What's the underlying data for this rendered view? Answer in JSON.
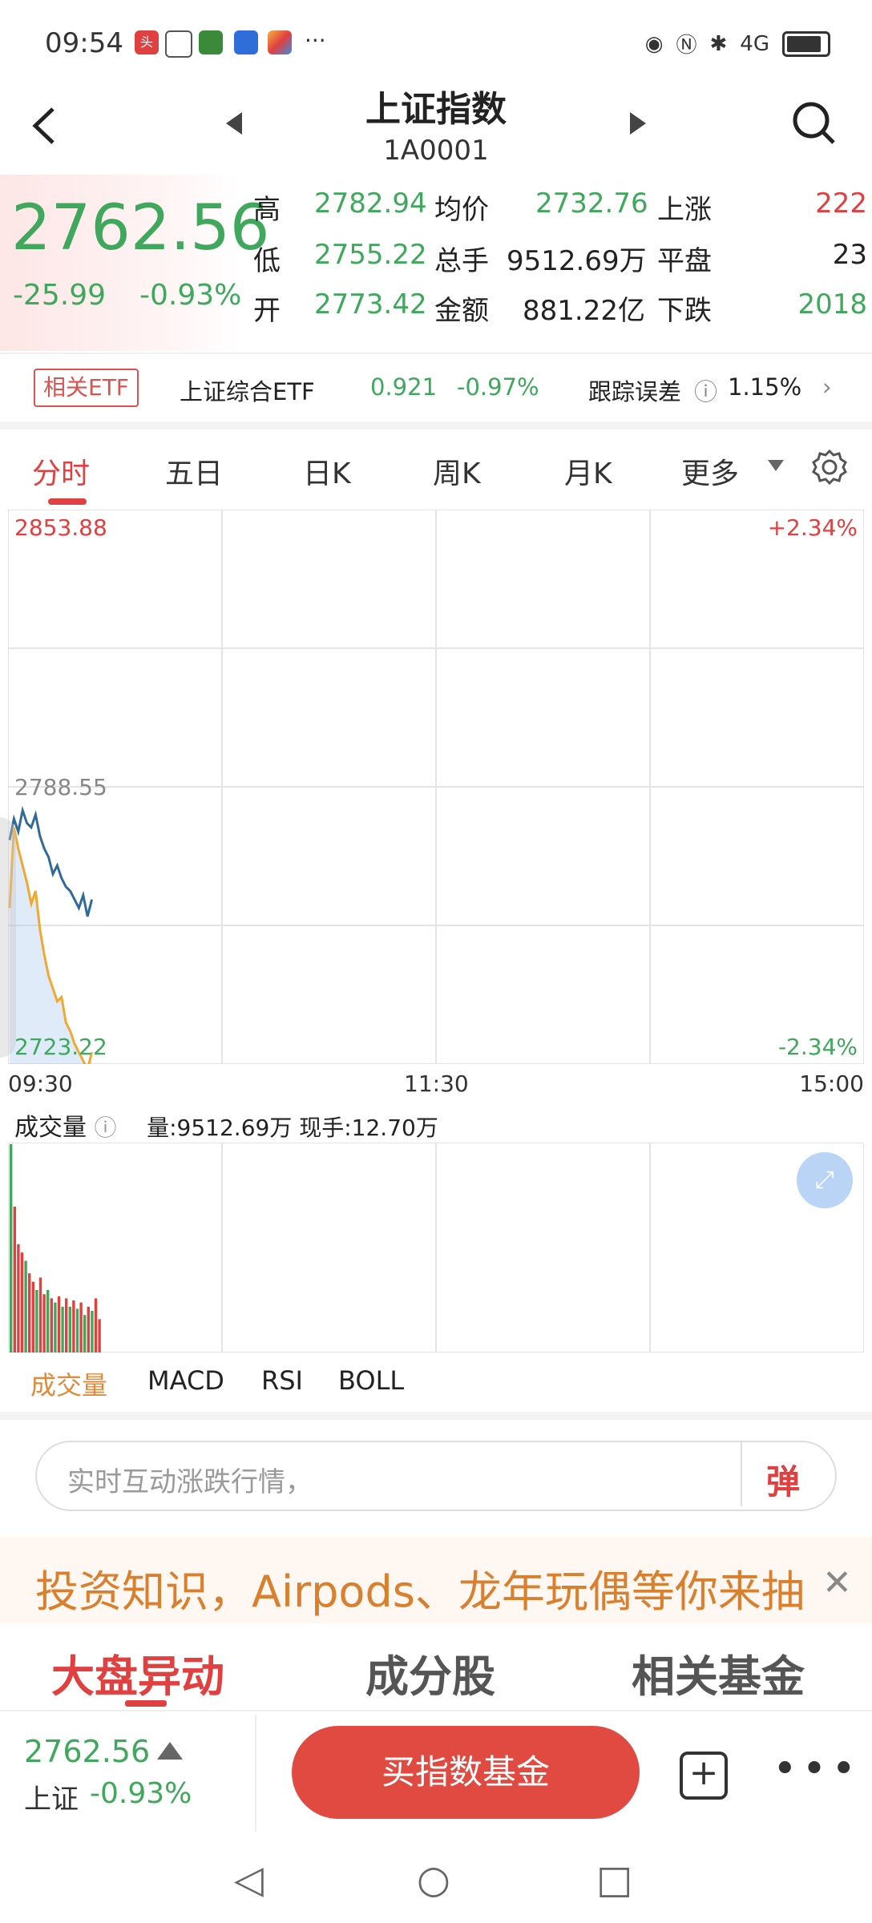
{
  "status": {
    "time": "09:54",
    "badge": "头条",
    "right": "4G"
  },
  "header": {
    "title": "上证指数",
    "code": "1A0001"
  },
  "quote": {
    "price": "2762.56",
    "change": "-25.99",
    "change_pct": "-0.93%",
    "high_label": "高",
    "high": "2782.94",
    "low_label": "低",
    "low": "2755.22",
    "open_label": "开",
    "open": "2773.42",
    "avg_label": "均价",
    "avg": "2732.76",
    "vol_label": "总手",
    "vol": "9512.69万",
    "amt_label": "金额",
    "amt": "881.22亿",
    "up_label": "上涨",
    "up": "222",
    "flat_label": "平盘",
    "flat": "23",
    "down_label": "下跌",
    "down": "2018"
  },
  "etf": {
    "badge": "相关ETF",
    "name": "上证综合ETF",
    "price": "0.921",
    "pct": "-0.97%",
    "track_label": "跟踪误差",
    "track": "1.15%"
  },
  "tabs": [
    "分时",
    "五日",
    "日K",
    "周K",
    "月K",
    "更多"
  ],
  "chart": {
    "top": "2853.88",
    "mid": "2788.55",
    "bottom": "2723.22",
    "top_pct": "+2.34%",
    "bottom_pct": "-2.34%",
    "times": [
      "09:30",
      "11:30",
      "15:00"
    ]
  },
  "chart_data": {
    "type": "line",
    "ylim": [
      2723.22,
      2853.88
    ],
    "series": [
      {
        "values": [
          2776,
          2781,
          2778,
          2783,
          2780,
          2779,
          2782,
          2777,
          2774,
          2772,
          2768,
          2770,
          2767,
          2765,
          2764,
          2762,
          2760,
          2763,
          2758,
          2762
        ]
      },
      {
        "values": [
          2760,
          2779,
          2774,
          2770,
          2766,
          2761,
          2764,
          2755,
          2749,
          2744,
          2741,
          2738,
          2739,
          2733,
          2731,
          2728,
          2726,
          2724,
          2722,
          2726
        ]
      }
    ]
  },
  "volume": {
    "title": "成交量",
    "info": "量:9512.69万 现手:12.70万",
    "bars": [
      100,
      70,
      52,
      48,
      44,
      38,
      34,
      30,
      36,
      28,
      30,
      26,
      24,
      27,
      22,
      26,
      22,
      25,
      21,
      24,
      18,
      22,
      20,
      26,
      16
    ],
    "colors": [
      "g",
      "r",
      "r",
      "r",
      "g",
      "r",
      "r",
      "g",
      "r",
      "r",
      "g",
      "r",
      "g",
      "r",
      "g",
      "r",
      "g",
      "r",
      "g",
      "r",
      "g",
      "r",
      "g",
      "r",
      "r"
    ]
  },
  "indicators": [
    "成交量",
    "MACD",
    "RSI",
    "BOLL"
  ],
  "comment": {
    "placeholder": "实时互动涨跌行情，",
    "dan": "弹"
  },
  "banner": {
    "text": "投资知识，Airpods、龙年玩偶等你来抽",
    "close": "✕"
  },
  "sections": [
    "大盘异动",
    "成分股",
    "相关基金"
  ],
  "bottom": {
    "price": "2762.56",
    "name": "上证",
    "pct": "-0.93%",
    "buy": "买指数基金",
    "plus": "+",
    "more": "•••"
  }
}
